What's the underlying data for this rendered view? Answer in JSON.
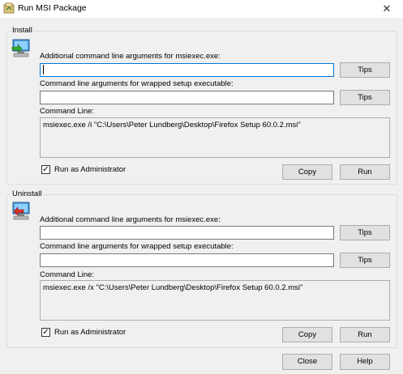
{
  "window": {
    "title": "Run MSI Package",
    "close_glyph": "✕"
  },
  "install": {
    "group_label": "Install",
    "additional_args_label": "Additional command line arguments for msiexec.exe:",
    "additional_args_value": "",
    "wrapped_args_label": "Command line arguments for wrapped setup executable:",
    "wrapped_args_value": "",
    "tips_label": "Tips",
    "command_line_label": "Command Line:",
    "command_line_value": "msiexec.exe /i \"C:\\Users\\Peter Lundberg\\Desktop\\Firefox Setup 60.0.2.msi\"",
    "run_as_admin_label": "Run as Administrator",
    "run_as_admin_checked": true,
    "copy_label": "Copy",
    "run_label": "Run"
  },
  "uninstall": {
    "group_label": "Uninstall",
    "additional_args_label": "Additional command line arguments for msiexec.exe:",
    "additional_args_value": "",
    "wrapped_args_label": "Command line arguments for wrapped setup executable:",
    "wrapped_args_value": "",
    "tips_label": "Tips",
    "command_line_label": "Command Line:",
    "command_line_value": "msiexec.exe /x \"C:\\Users\\Peter Lundberg\\Desktop\\Firefox Setup 60.0.2.msi\"",
    "run_as_admin_label": "Run as Administrator",
    "run_as_admin_checked": true,
    "copy_label": "Copy",
    "run_label": "Run"
  },
  "footer": {
    "close_label": "Close",
    "help_label": "Help"
  },
  "check_glyph": "✓",
  "icons": {
    "title": "msi-package-icon",
    "install": "install-computer-icon",
    "uninstall": "uninstall-computer-icon"
  }
}
